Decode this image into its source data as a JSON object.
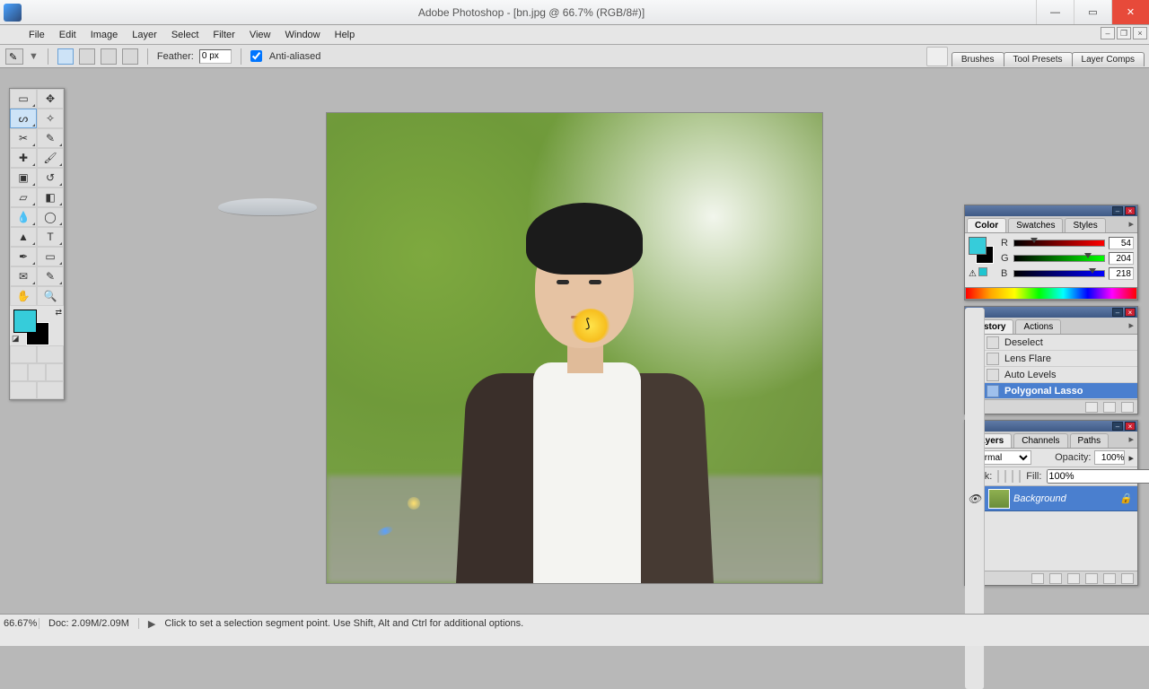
{
  "titlebar": {
    "title": "Adobe Photoshop - [bn.jpg @ 66.7% (RGB/8#)]"
  },
  "menu": [
    "File",
    "Edit",
    "Image",
    "Layer",
    "Select",
    "Filter",
    "View",
    "Window",
    "Help"
  ],
  "options": {
    "feather_label": "Feather:",
    "feather_value": "0 px",
    "antialias_label": "Anti-aliased",
    "tabs": [
      "Brushes",
      "Tool Presets",
      "Layer Comps"
    ]
  },
  "color_panel": {
    "tabs": [
      "Color",
      "Swatches",
      "Styles"
    ],
    "r_label": "R",
    "r_value": "54",
    "g_label": "G",
    "g_value": "204",
    "b_label": "B",
    "b_value": "218"
  },
  "history_panel": {
    "tabs": [
      "History",
      "Actions"
    ],
    "items": [
      {
        "label": "Deselect"
      },
      {
        "label": "Lens Flare"
      },
      {
        "label": "Auto Levels"
      },
      {
        "label": "Polygonal Lasso",
        "selected": true
      }
    ]
  },
  "layers_panel": {
    "tabs": [
      "Layers",
      "Channels",
      "Paths"
    ],
    "blend_label": "Normal",
    "opacity_label": "Opacity:",
    "opacity_value": "100%",
    "lock_label": "Lock:",
    "fill_label": "Fill:",
    "fill_value": "100%",
    "layer0": "Background"
  },
  "status": {
    "zoom": "66.67%",
    "doc": "Doc: 2.09M/2.09M",
    "hint": "Click to set a selection segment point.  Use Shift, Alt and Ctrl for additional options."
  }
}
